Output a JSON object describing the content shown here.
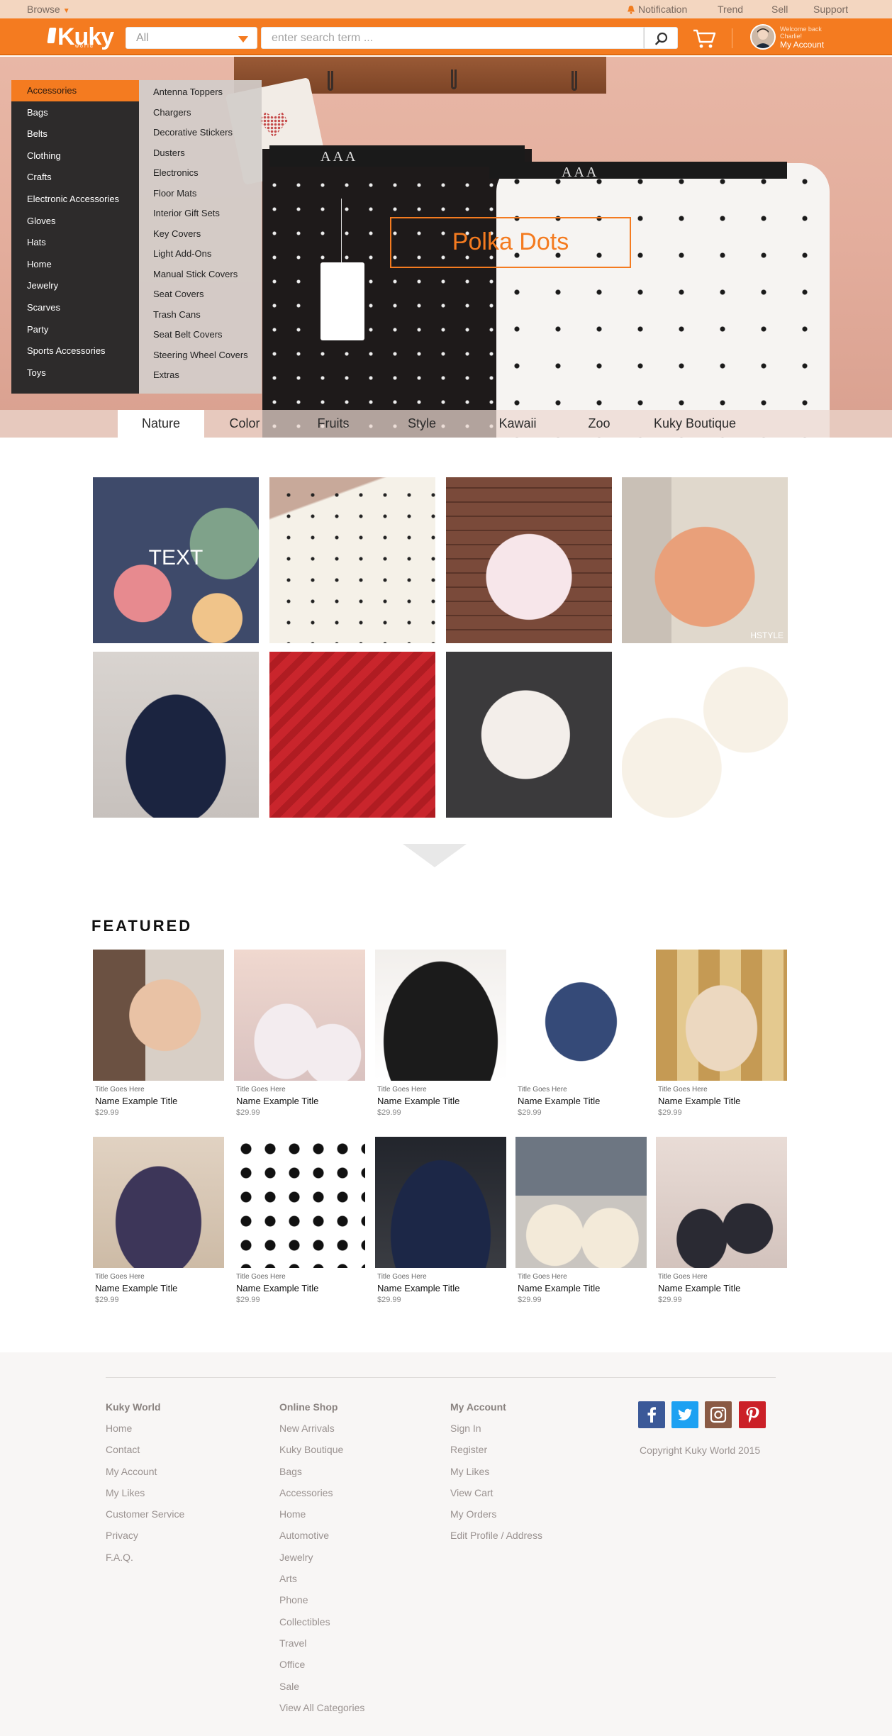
{
  "topbar": {
    "browse": "Browse",
    "links": [
      "Notification",
      "Trend",
      "Sell",
      "Support"
    ]
  },
  "header": {
    "logo": "Kuky",
    "logo_sub": "world",
    "category_select": "All",
    "search_placeholder": "enter search term ...",
    "welcome": "Welcome back",
    "user_name": "Charlie!",
    "account_label": "My Account"
  },
  "categories": [
    "Accessories",
    "Bags",
    "Belts",
    "Clothing",
    "Crafts",
    "Electronic Accessories",
    "Gloves",
    "Hats",
    "Home",
    "Jewelry",
    "Scarves",
    "Party",
    "Sports Accessories",
    "Toys"
  ],
  "subcategories": [
    "Antenna Toppers",
    "Chargers",
    "Decorative Stickers",
    "Dusters",
    "Electronics",
    "Floor Mats",
    "Interior Gift Sets",
    "Key Covers",
    "Light Add-Ons",
    "Manual Stick Covers",
    "Seat Covers",
    "Trash Cans",
    "Seat Belt Covers",
    "Steering Wheel Covers",
    "Extras"
  ],
  "hero": {
    "promo": "Polka Dots",
    "tag_aaa": "AAA"
  },
  "tabs": [
    "Nature",
    "Color",
    "Fruits",
    "Style",
    "Kawaii",
    "Zoo",
    "Kuky Boutique"
  ],
  "gallery": {
    "overlay_text": "TEXT",
    "watermark": "HSTYLE"
  },
  "featured": {
    "title": "FEATURED",
    "products": [
      {
        "title": "Title Goes Here",
        "name": "Name Example Title",
        "price": "$29.99"
      },
      {
        "title": "Title Goes Here",
        "name": "Name Example Title",
        "price": "$29.99"
      },
      {
        "title": "Title Goes Here",
        "name": "Name Example Title",
        "price": "$29.99"
      },
      {
        "title": "Title Goes Here",
        "name": "Name Example Title",
        "price": "$29.99"
      },
      {
        "title": "Title Goes Here",
        "name": "Name Example Title",
        "price": "$29.99"
      },
      {
        "title": "Title Goes Here",
        "name": "Name Example Title",
        "price": "$29.99"
      },
      {
        "title": "Title Goes Here",
        "name": "Name Example Title",
        "price": "$29.99"
      },
      {
        "title": "Title Goes Here",
        "name": "Name Example Title",
        "price": "$29.99"
      },
      {
        "title": "Title Goes Here",
        "name": "Name Example Title",
        "price": "$29.99"
      },
      {
        "title": "Title Goes Here",
        "name": "Name Example Title",
        "price": "$29.99"
      }
    ]
  },
  "footer": {
    "kuky_world": {
      "heading": "Kuky World",
      "links": [
        "Home",
        "Contact",
        "My Account",
        "My Likes",
        "Customer Service",
        "Privacy",
        "F.A.Q."
      ]
    },
    "online_shop": {
      "heading": "Online Shop",
      "links": [
        "New Arrivals",
        "Kuky Boutique",
        "Bags",
        "Accessories",
        "Home",
        "Automotive",
        "Jewelry",
        "Arts",
        "Phone",
        "Collectibles",
        "Travel",
        "Office",
        "Sale",
        "View All Categories"
      ]
    },
    "my_account": {
      "heading": "My Account",
      "links": [
        "Sign In",
        "Register",
        "My Likes",
        "View Cart",
        "My Orders",
        "Edit Profile / Address"
      ]
    },
    "social": [
      "facebook-icon",
      "twitter-icon",
      "instagram-icon",
      "pinterest-icon"
    ],
    "copyright": "Copyright Kuky World 2015"
  },
  "colors": {
    "accent": "#f47b20",
    "menu_dark": "#2d2b2b",
    "facebook": "#3b5998",
    "twitter": "#1da1f2",
    "instagram": "#8a5a44",
    "pinterest": "#cb2027"
  }
}
